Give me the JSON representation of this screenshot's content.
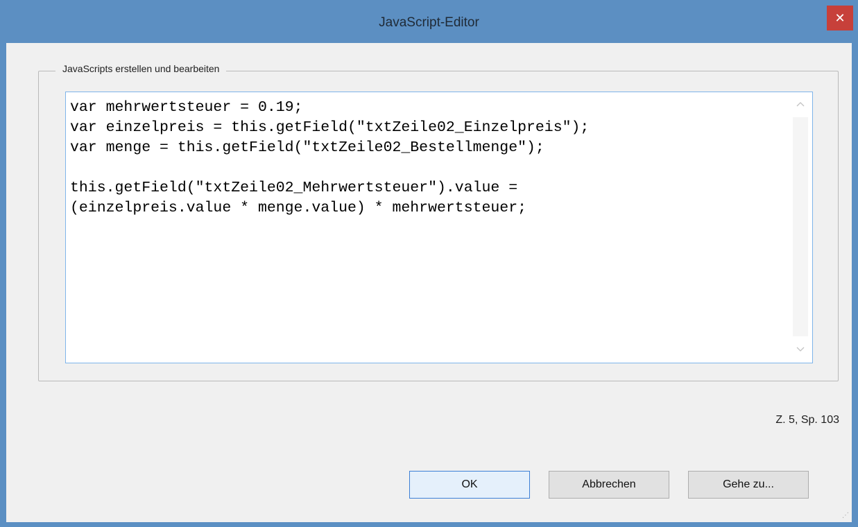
{
  "window": {
    "title": "JavaScript-Editor",
    "close_glyph": "✕"
  },
  "group": {
    "legend": "JavaScripts erstellen und bearbeiten"
  },
  "editor": {
    "code": "var mehrwertsteuer = 0.19;\nvar einzelpreis = this.getField(\"txtZeile02_Einzelpreis\");\nvar menge = this.getField(\"txtZeile02_Bestellmenge\");\n\nthis.getField(\"txtZeile02_Mehrwertsteuer\").value =\n(einzelpreis.value * menge.value) * mehrwertsteuer;",
    "scroll_up_icon": "chevron-up-icon",
    "scroll_down_icon": "chevron-down-icon"
  },
  "status": {
    "cursor_position": "Z. 5, Sp. 103"
  },
  "buttons": {
    "ok": "OK",
    "cancel": "Abbrechen",
    "goto": "Gehe zu..."
  },
  "colors": {
    "titlebar": "#5c8fc2",
    "close_button": "#c7403a",
    "editor_border": "#7eb4ea",
    "default_button_border": "#3c7fd6"
  }
}
